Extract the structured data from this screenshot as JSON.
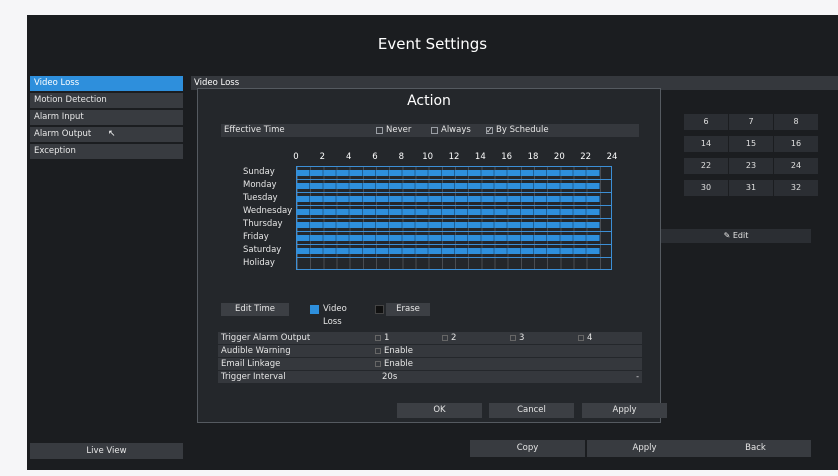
{
  "title": "Event Settings",
  "sidebar": {
    "items": [
      {
        "label": "Video Loss"
      },
      {
        "label": "Motion Detection"
      },
      {
        "label": "Alarm Input"
      },
      {
        "label": "Alarm Output"
      },
      {
        "label": "Exception"
      }
    ],
    "live_view": "Live View"
  },
  "main": {
    "header": "Video Loss",
    "channels": [
      6,
      7,
      8,
      14,
      15,
      16,
      22,
      23,
      24,
      30,
      31,
      32
    ],
    "edit_label": "Edit"
  },
  "footer": {
    "copy": "Copy",
    "apply": "Apply",
    "back": "Back"
  },
  "modal": {
    "title": "Action",
    "effective_time": {
      "label": "Effective Time",
      "options": [
        {
          "label": "Never",
          "checked": false
        },
        {
          "label": "Always",
          "checked": false
        },
        {
          "label": "By Schedule",
          "checked": true
        }
      ]
    },
    "schedule": {
      "hours": [
        "0",
        "2",
        "4",
        "6",
        "8",
        "10",
        "12",
        "14",
        "16",
        "18",
        "20",
        "22",
        "24"
      ],
      "days": [
        {
          "name": "Sunday",
          "start": 0,
          "end": 23
        },
        {
          "name": "Monday",
          "start": 0,
          "end": 23
        },
        {
          "name": "Tuesday",
          "start": 0,
          "end": 23
        },
        {
          "name": "Wednesday",
          "start": 0,
          "end": 23
        },
        {
          "name": "Thursday",
          "start": 0,
          "end": 23
        },
        {
          "name": "Friday",
          "start": 0,
          "end": 23
        },
        {
          "name": "Saturday",
          "start": 0,
          "end": 23
        },
        {
          "name": "Holiday",
          "start": 0,
          "end": 0
        }
      ],
      "edit_time": "Edit Time",
      "video_loss": "Video Loss",
      "erase": "Erase"
    },
    "actions": {
      "trigger_alarm_output": {
        "label": "Trigger Alarm Output",
        "channels": [
          "1",
          "2",
          "3",
          "4"
        ]
      },
      "audible_warning": {
        "label": "Audible Warning",
        "option": "Enable"
      },
      "email_linkage": {
        "label": "Email Linkage",
        "option": "Enable"
      },
      "trigger_interval": {
        "label": "Trigger Interval",
        "value": "20s"
      }
    },
    "buttons": {
      "ok": "OK",
      "cancel": "Cancel",
      "apply": "Apply"
    }
  },
  "colors": {
    "accent": "#2e8fdc",
    "background": "#1b1d20",
    "panel": "#24272b"
  }
}
